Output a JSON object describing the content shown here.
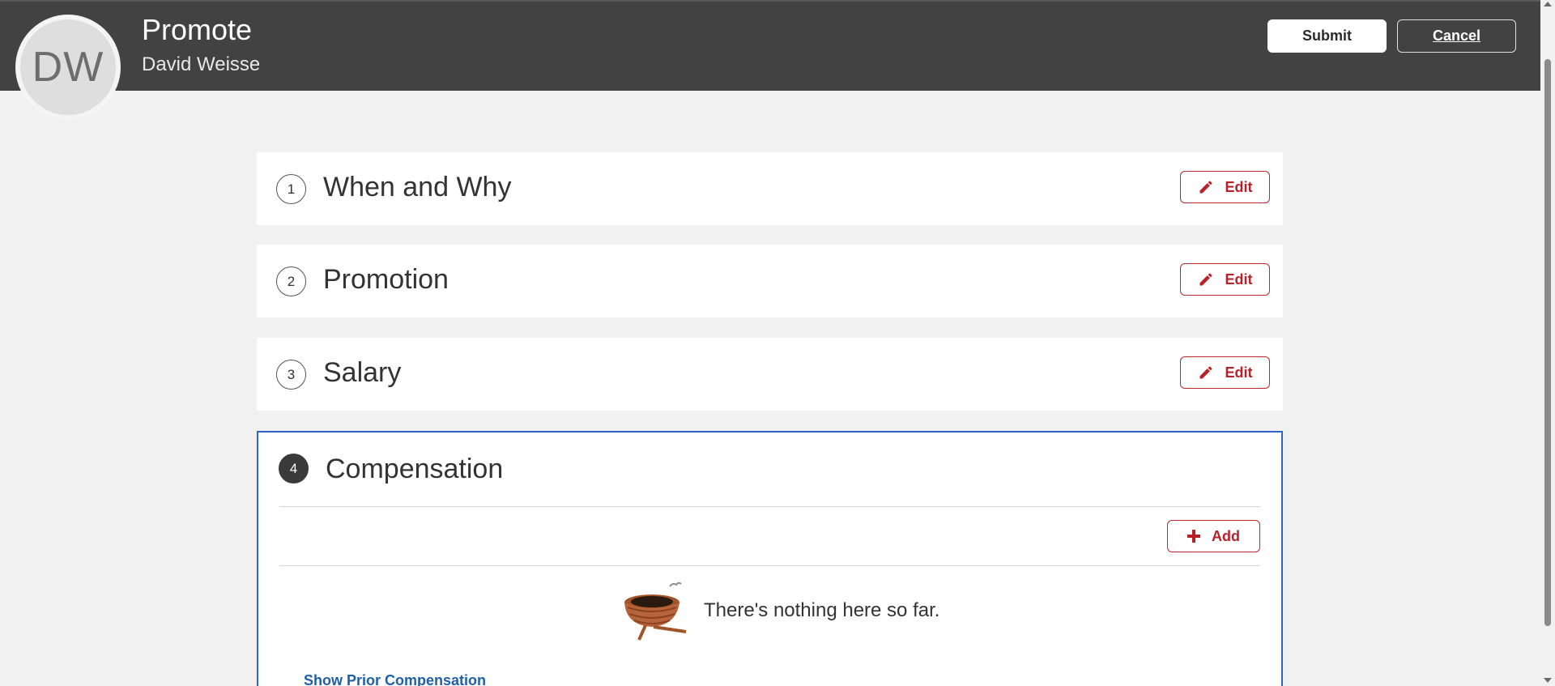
{
  "header": {
    "avatar_initials": "DW",
    "title": "Promote",
    "subtitle": "David Weisse",
    "submit_label": "Submit",
    "cancel_label": "Cancel"
  },
  "sections": [
    {
      "number": "1",
      "title": "When and Why",
      "action_label": "Edit",
      "state": "collapsed"
    },
    {
      "number": "2",
      "title": "Promotion",
      "action_label": "Edit",
      "state": "collapsed"
    },
    {
      "number": "3",
      "title": "Salary",
      "action_label": "Edit",
      "state": "collapsed"
    },
    {
      "number": "4",
      "title": "Compensation",
      "state": "active"
    }
  ],
  "compensation": {
    "add_label": "Add",
    "empty_message": "There's nothing here so far.",
    "show_prior_label": "Show Prior Compensation"
  },
  "icons": {
    "edit": "pencil-icon",
    "add": "plus-icon",
    "empty": "empty-nest-icon"
  },
  "colors": {
    "header_bg": "#424242",
    "accent_red": "#b8202a",
    "active_border": "#2f64c8",
    "link_blue": "#1f5fa8",
    "page_bg": "#f1f1f1"
  }
}
